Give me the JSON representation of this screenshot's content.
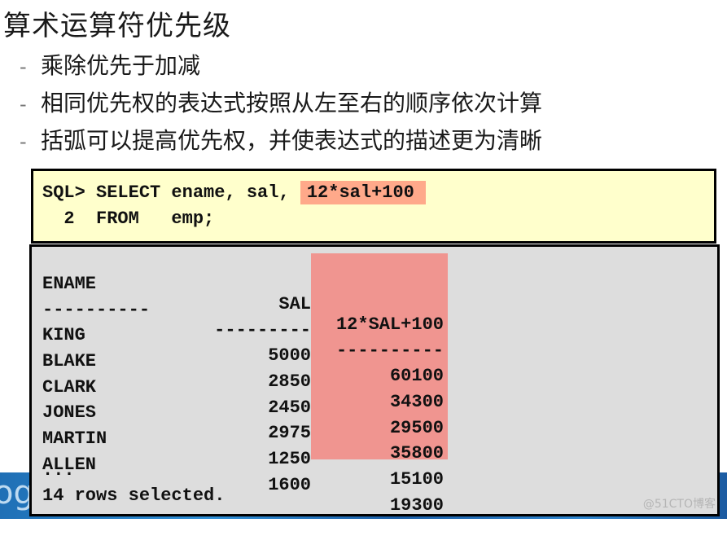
{
  "slide": {
    "title": "算术运算符优先级",
    "bullets": [
      "乘除优先于加减",
      "相同优先权的表达式按照从左至右的顺序依次计算",
      "括弧可以提高优先权，并使表达式的描述更为清晰"
    ],
    "bullet_marker": "-",
    "background_fragment": "ogr"
  },
  "query": {
    "prompt": "SQL>",
    "line1_prefix": "SELECT ename, sal,",
    "line1_highlight": "12*sal+100",
    "line2_number": "2",
    "line2_text": "FROM   emp;"
  },
  "result": {
    "headers": [
      "ENAME",
      "SAL",
      "12*SAL+100"
    ],
    "separators": [
      "----------",
      "---------",
      "----------"
    ],
    "rows": [
      [
        "KING",
        "5000",
        "60100"
      ],
      [
        "BLAKE",
        "2850",
        "34300"
      ],
      [
        "CLARK",
        "2450",
        "29500"
      ],
      [
        "JONES",
        "2975",
        "35800"
      ],
      [
        "MARTIN",
        "1250",
        "15100"
      ],
      [
        "ALLEN",
        "1600",
        "19300"
      ]
    ],
    "ellipsis": "...",
    "footer": "14 rows selected."
  },
  "colors": {
    "query_bg": "#ffffcc",
    "result_bg": "#dddddd",
    "query_highlight": "#ffa98a",
    "column_highlight": "#f09590"
  },
  "watermark": "@51CTO博客"
}
